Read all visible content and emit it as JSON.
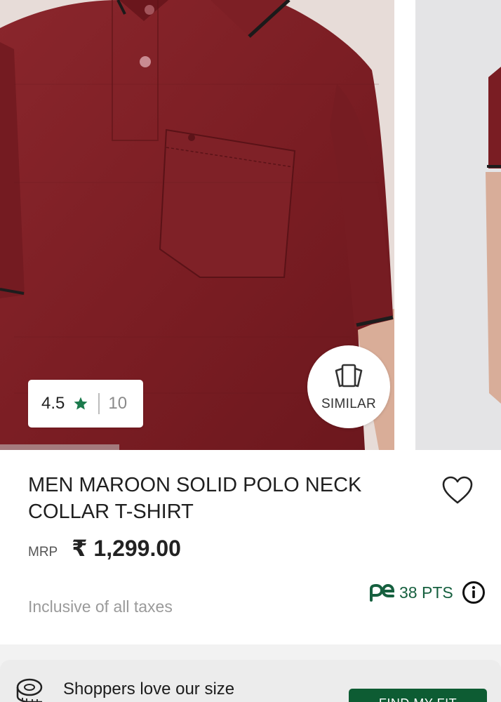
{
  "gallery": {
    "rating": {
      "value": "4.5",
      "count": "10"
    },
    "similar_label": "SIMILAR"
  },
  "product": {
    "title": "MEN MAROON SOLID POLO NECK COLLAR T-SHIRT",
    "mrp_label": "MRP",
    "price": "₹ 1,299.00",
    "points": "38 PTS",
    "tax_note": "Inclusive of all taxes"
  },
  "size_banner": {
    "text": "Shoppers love our size",
    "button_label": "FIND MY FIT"
  },
  "colors": {
    "star": "#1b7a4c",
    "brand_green": "#0d5c33",
    "shirt": "#7c1e24"
  },
  "icons": [
    "star-icon",
    "similar-icon",
    "heart-icon",
    "pe-logo-icon",
    "info-icon",
    "measuring-tape-icon"
  ]
}
